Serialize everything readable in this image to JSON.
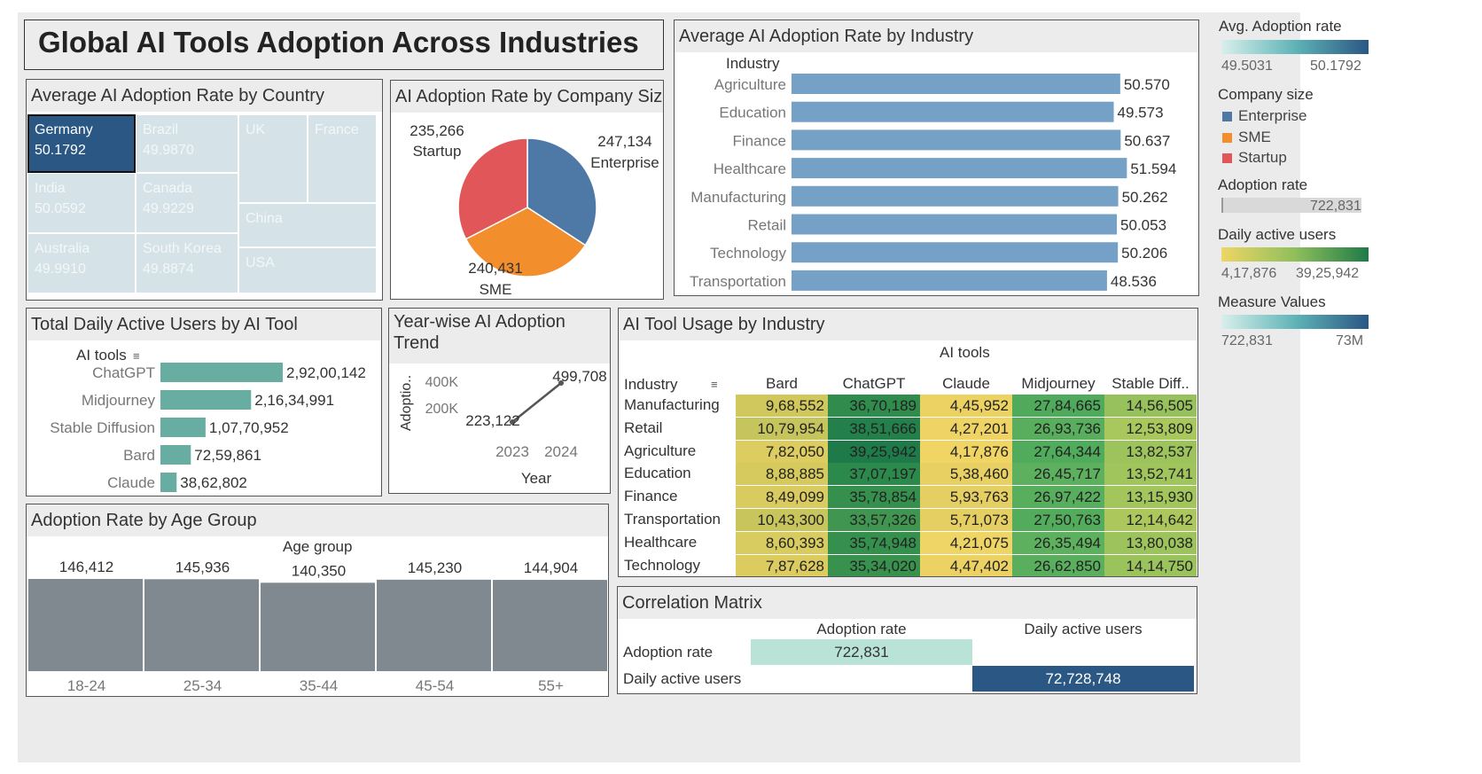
{
  "title": "Global AI Tools Adoption Across Industries",
  "country": {
    "title": "Average AI Adoption Rate by Country",
    "cells": [
      {
        "name": "Germany",
        "value": "50.1792"
      },
      {
        "name": "Brazil",
        "value": "49.9870"
      },
      {
        "name": "UK",
        "value": ""
      },
      {
        "name": "France",
        "value": ""
      },
      {
        "name": "India",
        "value": "50.0592"
      },
      {
        "name": "Canada",
        "value": "49.9229"
      },
      {
        "name": "China",
        "value": ""
      },
      {
        "name": "Australia",
        "value": "49.9910"
      },
      {
        "name": "South Korea",
        "value": "49.8874"
      },
      {
        "name": "USA",
        "value": ""
      }
    ],
    "colors": {
      "selected": "#2a5783",
      "faded": "#d5e3e8"
    }
  },
  "company": {
    "title": "AI Adoption Rate by Company Size",
    "chart_data": {
      "type": "pie",
      "labels": [
        "Enterprise",
        "SME",
        "Startup"
      ],
      "values": [
        247134,
        240431,
        235266
      ],
      "value_labels": [
        "247,134",
        "240,431",
        "235,266"
      ],
      "colors": [
        "#4e79a7",
        "#f28e2b",
        "#e15759"
      ]
    }
  },
  "industry": {
    "title": "Average AI Adoption Rate by Industry",
    "header": "Industry",
    "chart_data": {
      "type": "bar",
      "categories": [
        "Agriculture",
        "Education",
        "Finance",
        "Healthcare",
        "Manufacturing",
        "Retail",
        "Technology",
        "Transportation"
      ],
      "values": [
        50.57,
        49.573,
        50.637,
        51.594,
        50.262,
        50.053,
        50.206,
        48.536
      ],
      "value_labels": [
        "50.570",
        "49.573",
        "50.637",
        "51.594",
        "50.262",
        "50.053",
        "50.206",
        "48.536"
      ],
      "color": "#75a1c7"
    }
  },
  "tools": {
    "title": "Total Daily Active Users by AI Tool",
    "header": "AI tools",
    "chart_data": {
      "type": "bar",
      "categories": [
        "ChatGPT",
        "Midjourney",
        "Stable Diffusion",
        "Bard",
        "Claude"
      ],
      "values": [
        29200142,
        21634991,
        10770952,
        7259861,
        3862802
      ],
      "value_labels": [
        "2,92,00,142",
        "2,16,34,991",
        "1,07,70,952",
        "72,59,861",
        "38,62,802"
      ],
      "color": "#68ada1"
    }
  },
  "trend": {
    "title_line1": "Year-wise AI Adoption",
    "title_line2": "Trend",
    "ylabel": "Adoptio..",
    "xlabel": "Year",
    "chart_data": {
      "type": "line",
      "x": [
        "2023",
        "2024"
      ],
      "values": [
        223122,
        499708
      ],
      "value_labels": [
        "223,122",
        "499,708"
      ],
      "yticks": [
        "400K",
        "200K"
      ]
    }
  },
  "usage": {
    "title": "AI Tool Usage by Industry",
    "column_group": "AI tools",
    "row_header": "Industry",
    "columns": [
      "Bard",
      "ChatGPT",
      "Claude",
      "Midjourney",
      "Stable Diff.."
    ],
    "rows": [
      {
        "industry": "Manufacturing",
        "cells": [
          "9,68,552",
          "36,70,189",
          "4,45,952",
          "27,84,665",
          "14,56,505"
        ],
        "colors": [
          "#d1c85d",
          "#2f8c4c",
          "#ecd263",
          "#4faa5b",
          "#97c15c"
        ]
      },
      {
        "industry": "Retail",
        "cells": [
          "10,79,954",
          "38,51,666",
          "4,27,201",
          "26,93,736",
          "12,53,809"
        ],
        "colors": [
          "#c6c45d",
          "#23804a",
          "#efd465",
          "#58ae5d",
          "#a8c75d"
        ]
      },
      {
        "industry": "Agriculture",
        "cells": [
          "7,82,050",
          "39,25,942",
          "4,17,876",
          "27,64,344",
          "13,82,537"
        ],
        "colors": [
          "#ddcc5f",
          "#1e7a48",
          "#f0d565",
          "#51ab5c",
          "#9dc45c"
        ]
      },
      {
        "industry": "Education",
        "cells": [
          "8,88,885",
          "37,07,197",
          "5,38,460",
          "26,45,717",
          "13,52,741"
        ],
        "colors": [
          "#d6ca5e",
          "#2b894b",
          "#e8d062",
          "#5cb05e",
          "#a0c55c"
        ]
      },
      {
        "industry": "Finance",
        "cells": [
          "8,49,099",
          "35,78,854",
          "5,93,763",
          "26,97,422",
          "13,15,930"
        ],
        "colors": [
          "#d9cb5f",
          "#35904d",
          "#e5cf62",
          "#57ae5d",
          "#a3c65c"
        ]
      },
      {
        "industry": "Transportation",
        "cells": [
          "10,43,300",
          "33,57,326",
          "5,71,073",
          "27,50,763",
          "12,14,642"
        ],
        "colors": [
          "#c9c55d",
          "#409650",
          "#e6cf62",
          "#52ac5c",
          "#acc85d"
        ]
      },
      {
        "industry": "Healthcare",
        "cells": [
          "8,60,393",
          "35,74,948",
          "4,21,075",
          "26,35,494",
          "13,80,038"
        ],
        "colors": [
          "#d8cb5f",
          "#35904d",
          "#efd565",
          "#5db15e",
          "#9dc45c"
        ]
      },
      {
        "industry": "Technology",
        "cells": [
          "7,87,628",
          "35,34,020",
          "4,47,402",
          "26,62,850",
          "14,14,750"
        ],
        "colors": [
          "#dccc5f",
          "#38924e",
          "#ecd263",
          "#5aaf5e",
          "#9ac35c"
        ]
      }
    ]
  },
  "age": {
    "title": "Adoption Rate by Age Group",
    "header": "Age group",
    "chart_data": {
      "type": "bar",
      "categories": [
        "18-24",
        "25-34",
        "35-44",
        "45-54",
        "55+"
      ],
      "values": [
        146412,
        145936,
        140350,
        145230,
        144904
      ],
      "value_labels": [
        "146,412",
        "145,936",
        "140,350",
        "145,230",
        "144,904"
      ],
      "color": "#808890"
    }
  },
  "corr": {
    "title": "Correlation Matrix",
    "columns": [
      "Adoption rate",
      "Daily active users"
    ],
    "rows": [
      "Adoption rate",
      "Daily active users"
    ],
    "cells": [
      [
        "722,831",
        ""
      ],
      [
        "",
        "72,728,748"
      ]
    ],
    "colors": {
      "low": "#b8e3d6",
      "high": "#2a5783"
    }
  },
  "legend": {
    "avg_title": "Avg. Adoption rate",
    "avg_min": "49.5031",
    "avg_max": "50.1792",
    "size_title": "Company size",
    "size_items": [
      {
        "label": "Enterprise",
        "color": "#4e79a7"
      },
      {
        "label": "SME",
        "color": "#f28e2b"
      },
      {
        "label": "Startup",
        "color": "#e15759"
      }
    ],
    "rate_title": "Adoption rate",
    "rate_value": "722,831",
    "dau_title": "Daily active users",
    "dau_min": "4,17,876",
    "dau_max": "39,25,942",
    "mv_title": "Measure Values",
    "mv_min": "722,831",
    "mv_max": "73M"
  }
}
